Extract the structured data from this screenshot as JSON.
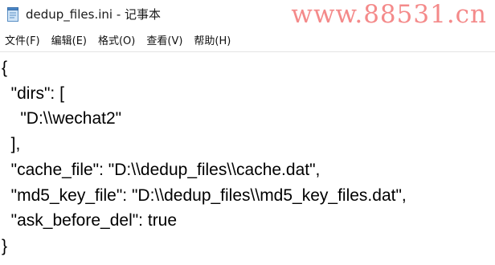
{
  "window": {
    "title": "dedup_files.ini - 记事本",
    "watermark": "www.88531.cn"
  },
  "menu": [
    {
      "label": "文件(F)"
    },
    {
      "label": "编辑(E)"
    },
    {
      "label": "格式(O)"
    },
    {
      "label": "查看(V)"
    },
    {
      "label": "帮助(H)"
    }
  ],
  "content": {
    "lines": [
      "{",
      "  \"dirs\": [",
      "    \"D:\\\\wechat2\"",
      "  ],",
      "  \"cache_file\": \"D:\\\\dedup_files\\\\cache.dat\",",
      "  \"md5_key_file\": \"D:\\\\dedup_files\\\\md5_key_files.dat\",",
      "  \"ask_before_del\": true",
      "}"
    ]
  },
  "icons": {
    "app": "notepad-icon"
  }
}
